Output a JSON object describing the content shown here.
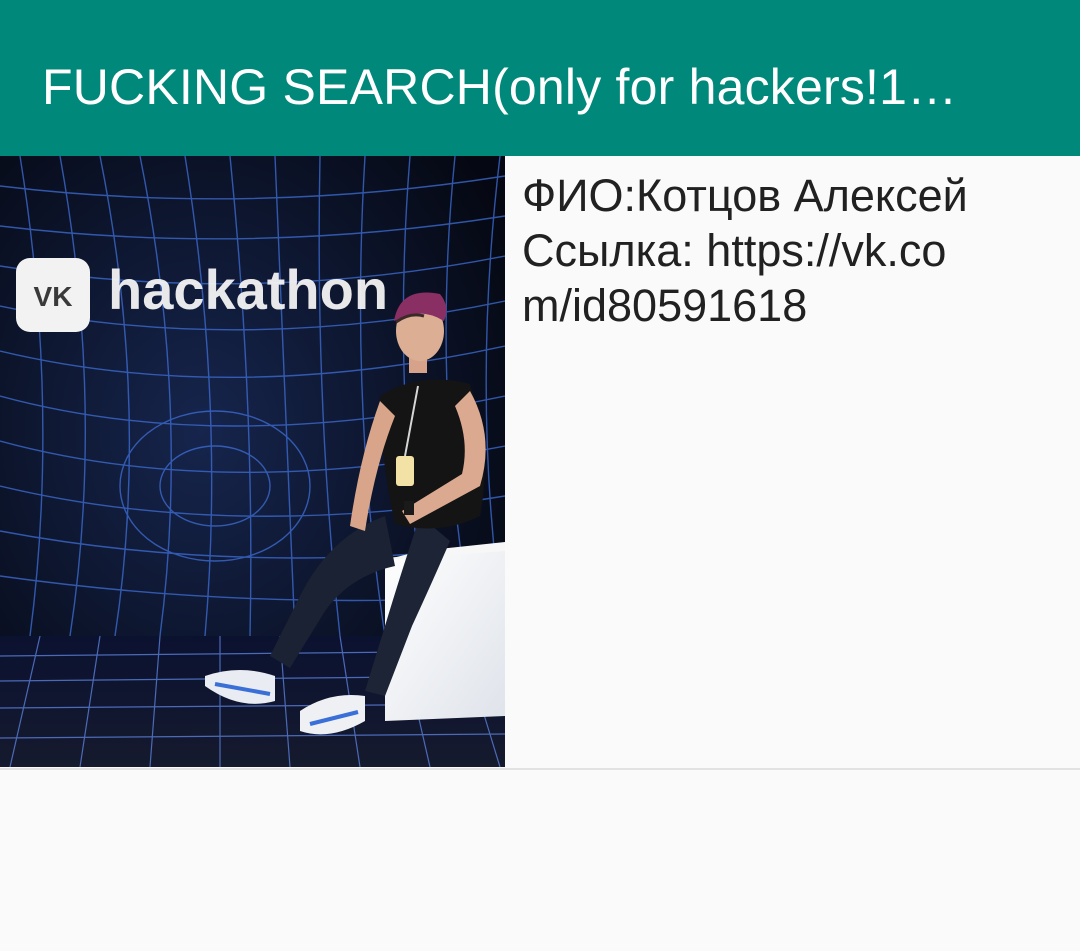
{
  "toolbar": {
    "title": "FUCKING SEARCH(only for hackers!1…"
  },
  "result": {
    "name_line": "ФИО:Котцов Алексей",
    "link_line": "Ссылка: https://vk.com/id80591618"
  },
  "photo": {
    "sign_text": "hackathon",
    "sign_logo": "VK"
  },
  "colors": {
    "toolbar": "#00897b",
    "background": "#fafafa",
    "text": "#212121",
    "photo_grid": "#3f6fd8"
  }
}
